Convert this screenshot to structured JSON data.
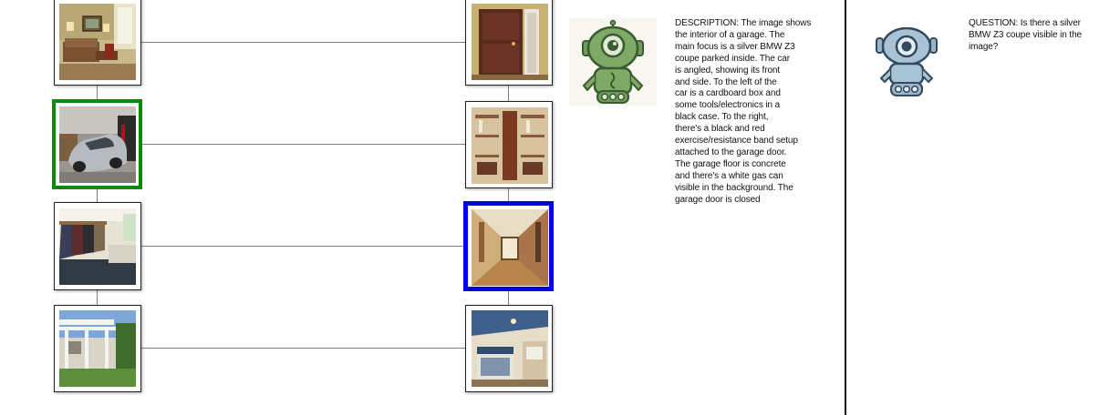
{
  "left_column": {
    "images": [
      {
        "subject": "living room",
        "highlight": "none"
      },
      {
        "subject": "garage with silver car",
        "highlight": "green"
      },
      {
        "subject": "mudroom with coats",
        "highlight": "none"
      },
      {
        "subject": "house with white pergola",
        "highlight": "none"
      }
    ]
  },
  "right_column": {
    "images": [
      {
        "subject": "wooden front door",
        "highlight": "none"
      },
      {
        "subject": "closet with shelves",
        "highlight": "none"
      },
      {
        "subject": "long hallway",
        "highlight": "blue"
      },
      {
        "subject": "bedroom",
        "highlight": "none"
      }
    ]
  },
  "describer": {
    "avatar_icon": "green-robot-icon",
    "text": "DESCRIPTION: The image shows\nthe interior of a garage. The\nmain focus is a silver BMW Z3\ncoupe parked inside. The car\nis angled, showing its front\nand side. To the left of the\ncar is a cardboard box and\nsome tools/electronics in a\nblack case. To the right,\nthere's a black and red\nexercise/resistance band setup\nattached to the garage door.\nThe garage floor is concrete\nand there's a white gas can\nvisible in the background. The\ngarage door is closed"
  },
  "questioner": {
    "avatar_icon": "blue-robot-icon",
    "text": "QUESTION: Is there a silver\nBMW Z3 coupe visible in the\nimage?"
  },
  "colors": {
    "highlight_green": "#0a8a0a",
    "highlight_blue": "#0000ee",
    "connector": "#808080",
    "divider": "#111111"
  }
}
